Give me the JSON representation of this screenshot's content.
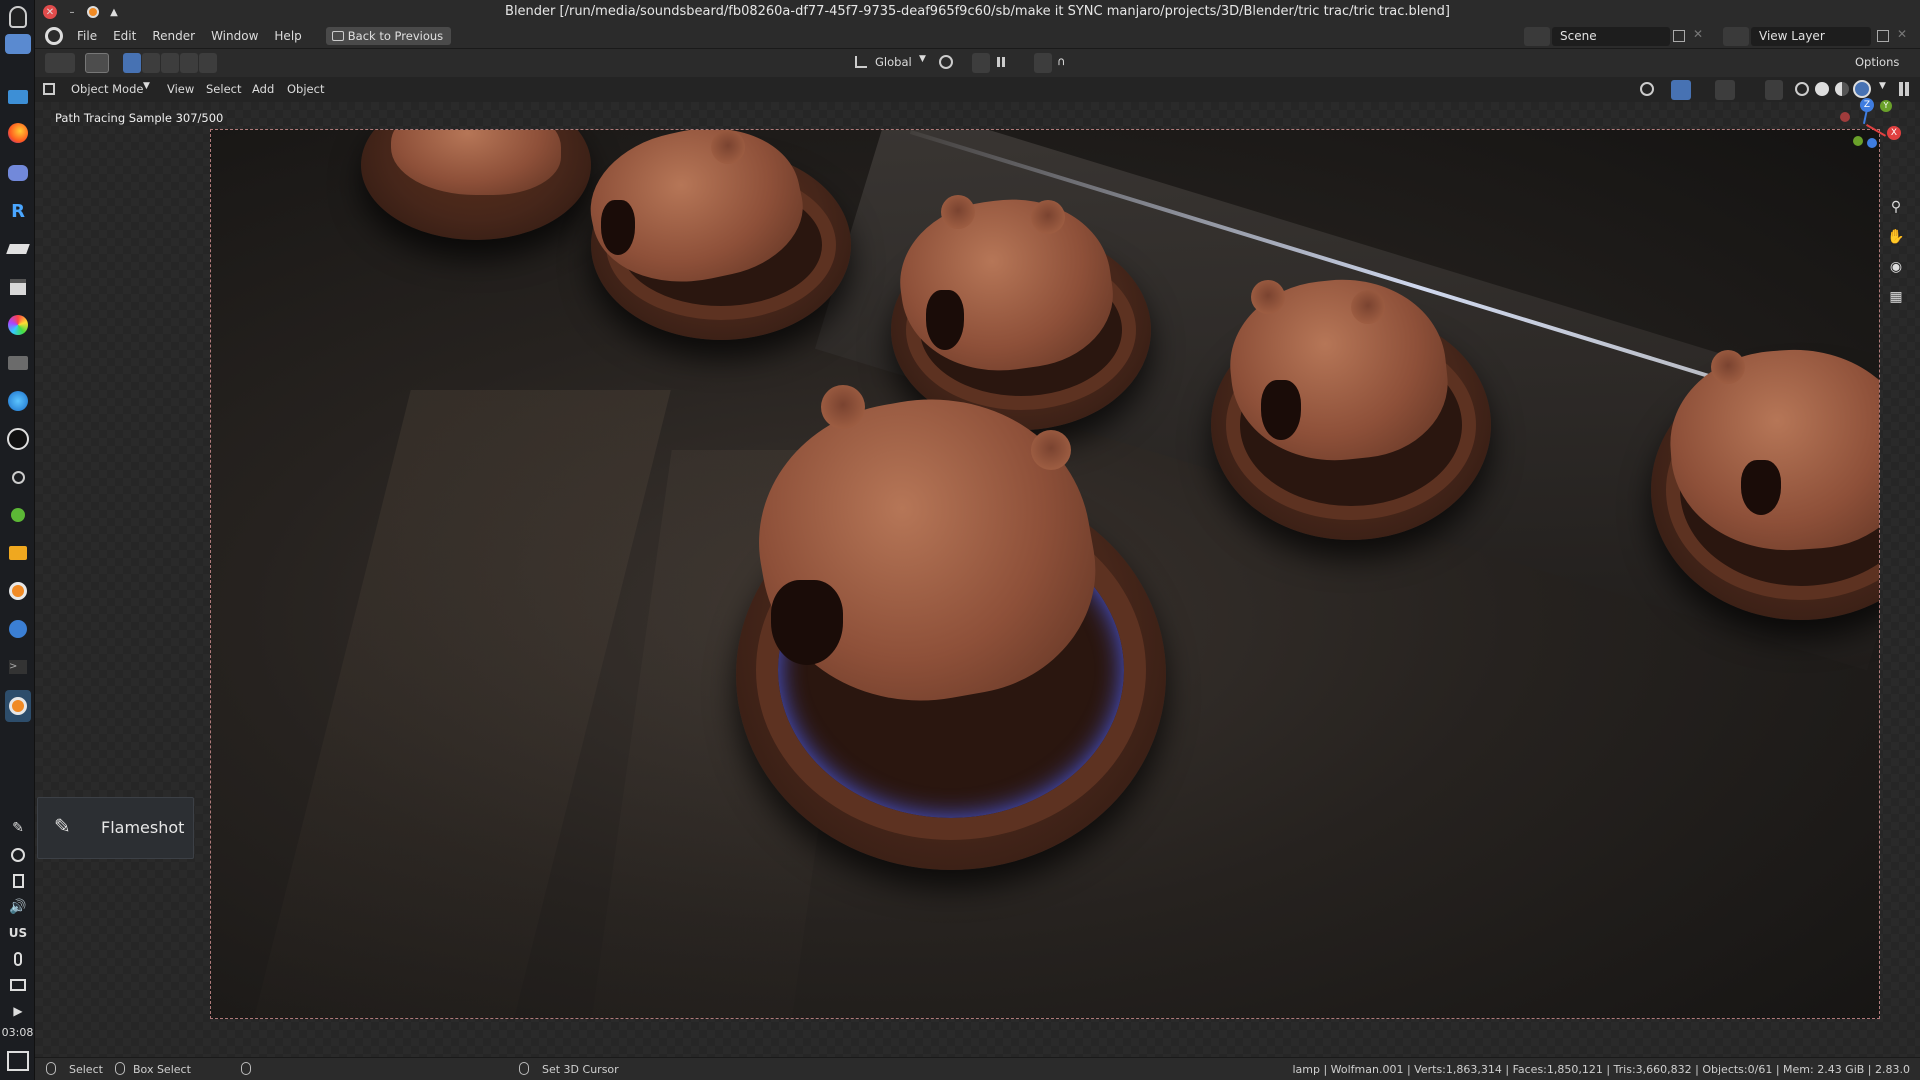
{
  "window": {
    "title": "Blender [/run/media/soundsbeard/fb08260a-df77-45f7-9735-deaf965f9c60/sb/make it SYNC manjaro/projects/3D/Blender/tric trac/tric trac.blend]"
  },
  "menubar": {
    "items": [
      "File",
      "Edit",
      "Render",
      "Window",
      "Help"
    ],
    "back_button": "Back to Previous",
    "scene_label": "Scene",
    "view_layer_label": "View Layer"
  },
  "tool_settings": {
    "orientation": "Global",
    "options_label": "Options"
  },
  "viewport_header": {
    "mode": "Object Mode",
    "menus": [
      "View",
      "Select",
      "Add",
      "Object"
    ]
  },
  "viewport": {
    "render_status": "Path Tracing Sample 307/500",
    "gizmo_axes": [
      "Z",
      "Y",
      "X"
    ]
  },
  "taskbar": {
    "clock": "03:08",
    "keyboard_layout": "US"
  },
  "toast": {
    "label": "Flameshot"
  },
  "statusbar": {
    "select": "Select",
    "box_select": "Box Select",
    "set_cursor": "Set 3D Cursor",
    "stats": "lamp | Wolfman.001 | Verts:1,863,314 | Faces:1,850,121 | Tris:3,660,832 | Objects:0/61 | Mem: 2.43 GiB | 2.83.0"
  },
  "colors": {
    "accent": "#4772b3",
    "panel": "#2b2b2b",
    "viewport_header": "#242424",
    "taskbar": "#1b1d21"
  }
}
